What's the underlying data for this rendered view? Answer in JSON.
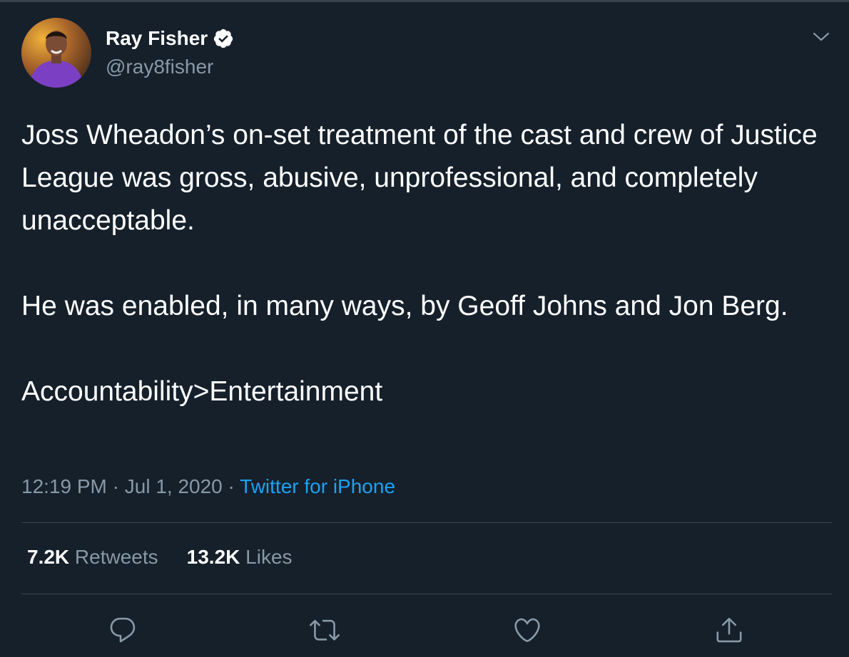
{
  "user": {
    "name": "Ray Fisher",
    "handle": "@ray8fisher",
    "verified": true
  },
  "tweet": {
    "paragraphs": [
      "Joss Wheadon’s on-set treatment of the cast and crew of Justice League was gross, abusive, unprofessional, and completely unacceptable.",
      "He was enabled, in many ways, by Geoff Johns and Jon Berg.",
      "Accountability>Entertainment"
    ],
    "time": "12:19 PM",
    "date": "Jul 1, 2020",
    "separator": " · ",
    "source": "Twitter for iPhone"
  },
  "stats": {
    "retweets_count": "7.2K",
    "retweets_label": " Retweets",
    "likes_count": "13.2K",
    "likes_label": " Likes"
  },
  "actions": [
    "reply-icon",
    "retweet-icon",
    "like-icon",
    "share-icon"
  ],
  "colors": {
    "background": "#15202b",
    "text": "#ffffff",
    "secondary": "#8899a6",
    "link": "#1da1f2",
    "divider": "#38444d"
  }
}
